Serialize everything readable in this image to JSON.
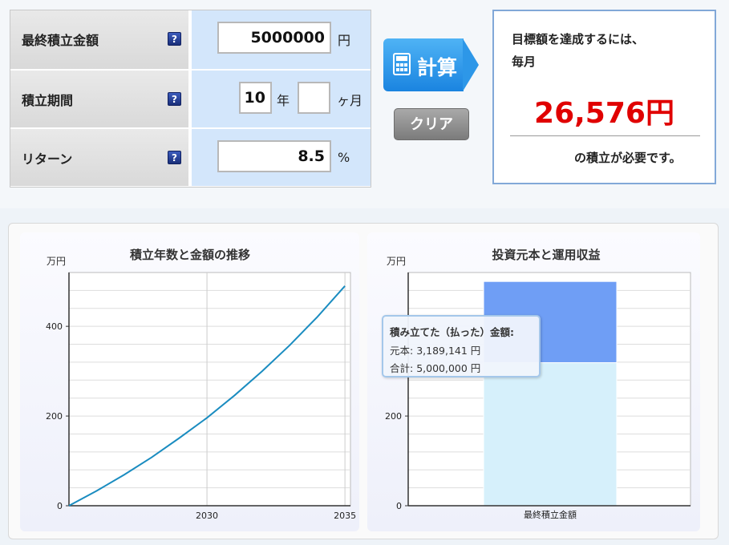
{
  "form": {
    "rows": [
      {
        "label": "最終積立金額",
        "value": "5000000",
        "unit": "円"
      },
      {
        "label": "積立期間",
        "years": "10",
        "years_unit": "年",
        "months": "",
        "months_unit": "ヶ月"
      },
      {
        "label": "リターン",
        "value": "8.5",
        "unit": "%"
      }
    ],
    "help_glyph": "?"
  },
  "buttons": {
    "calc_label": "計算",
    "clear_label": "クリア"
  },
  "result": {
    "line1": "目標額を達成するには、",
    "line2": "毎月",
    "amount": "26,576円",
    "line3": "の積立が必要です。"
  },
  "tooltip": {
    "title": "積み立てた（払った）金額:",
    "principal_label": "元本:",
    "principal_value": "3,189,141 円",
    "total_label": "合計:",
    "total_value": "5,000,000 円"
  },
  "chart_data": [
    {
      "type": "line",
      "title": "積立年数と金額の推移",
      "ylabel": "万円",
      "x": [
        2025,
        2026,
        2027,
        2028,
        2029,
        2030,
        2031,
        2032,
        2033,
        2034,
        2035
      ],
      "x_ticks": [
        "2030",
        "2035"
      ],
      "y_ticks": [
        "0",
        "200",
        "400"
      ],
      "ylim": [
        0,
        520
      ],
      "xlim": [
        2025,
        2035.2
      ],
      "series": [
        {
          "values": [
            0,
            33,
            69,
            108,
            151,
            196,
            246,
            300,
            358,
            421,
            490
          ],
          "color": "#1a8cc0"
        }
      ],
      "grid": true
    },
    {
      "type": "bar",
      "title": "投資元本と運用収益",
      "ylabel": "万円",
      "categories": [
        "最終積立金額"
      ],
      "y_ticks": [
        "0",
        "200"
      ],
      "ylim": [
        0,
        520
      ],
      "series": [
        {
          "values": [
            319
          ],
          "color": "#d6f0fb"
        },
        {
          "values": [
            181
          ],
          "color": "#6f9ef5"
        }
      ],
      "stacked": true,
      "grid": true
    }
  ]
}
